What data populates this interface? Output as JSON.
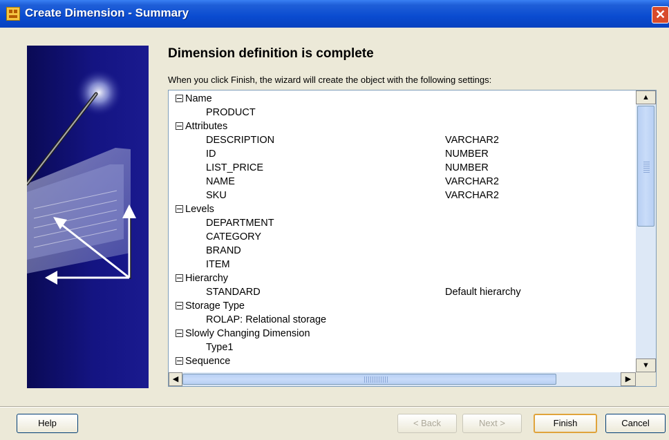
{
  "window": {
    "title": "Create Dimension - Summary",
    "close_glyph": "✕"
  },
  "content": {
    "heading": "Dimension definition is complete",
    "description": "When you click Finish, the wizard will create the object with the following settings:"
  },
  "tree": {
    "rows": [
      {
        "level": 0,
        "label": "Name"
      },
      {
        "level": 1,
        "label": "PRODUCT",
        "value": ""
      },
      {
        "level": 0,
        "label": "Attributes"
      },
      {
        "level": 1,
        "label": "DESCRIPTION",
        "value": "VARCHAR2"
      },
      {
        "level": 1,
        "label": "ID",
        "value": "NUMBER"
      },
      {
        "level": 1,
        "label": "LIST_PRICE",
        "value": "NUMBER"
      },
      {
        "level": 1,
        "label": "NAME",
        "value": "VARCHAR2"
      },
      {
        "level": 1,
        "label": "SKU",
        "value": "VARCHAR2"
      },
      {
        "level": 0,
        "label": "Levels"
      },
      {
        "level": 1,
        "label": "DEPARTMENT",
        "value": ""
      },
      {
        "level": 1,
        "label": "CATEGORY",
        "value": ""
      },
      {
        "level": 1,
        "label": "BRAND",
        "value": ""
      },
      {
        "level": 1,
        "label": "ITEM",
        "value": ""
      },
      {
        "level": 0,
        "label": "Hierarchy"
      },
      {
        "level": 1,
        "label": "STANDARD",
        "value": "Default hierarchy"
      },
      {
        "level": 0,
        "label": "Storage Type"
      },
      {
        "level": 1,
        "label": "ROLAP: Relational storage",
        "value": ""
      },
      {
        "level": 0,
        "label": "Slowly Changing Dimension"
      },
      {
        "level": 1,
        "label": "Type1",
        "value": ""
      },
      {
        "level": 0,
        "label": "Sequence"
      }
    ]
  },
  "scrollbar": {
    "up_glyph": "▲",
    "down_glyph": "▼",
    "left_glyph": "◀",
    "right_glyph": "▶"
  },
  "buttons": {
    "help": "Help",
    "back": "< Back",
    "next": "Next >",
    "finish": "Finish",
    "cancel": "Cancel"
  },
  "colors": {
    "titlebar": "#0a4bd0",
    "side_panel": "#141482",
    "default_button_border": "#e0a33a"
  }
}
